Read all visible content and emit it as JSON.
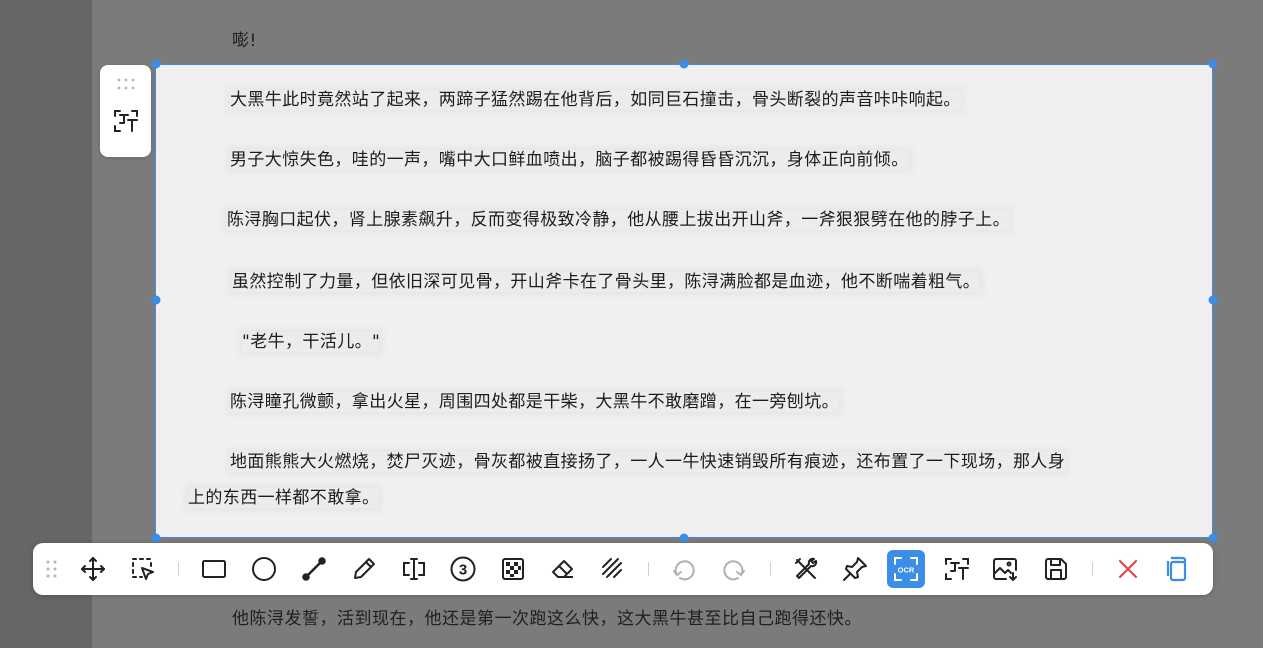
{
  "background_text": {
    "top_line": "嘭!",
    "bottom_line": "他陈浔发誓，活到现在，他还是第一次跑这么快，这大黑牛甚至比自己跑得还快。"
  },
  "selection_paragraphs": [
    "大黑牛此时竟然站了起来，两蹄子猛然踢在他背后，如同巨石撞击，骨头断裂的声音咔咔响起。",
    "男子大惊失色，哇的一声，嘴中大口鲜血喷出，脑子都被踢得昏昏沉沉，身体正向前倾。",
    "陈浔胸口起伏，肾上腺素飙升，反而变得极致冷静，他从腰上拔出开山斧，一斧狠狠劈在他的脖子上。",
    "虽然控制了力量，但依旧深可见骨，开山斧卡在了骨头里，陈浔满脸都是血迹，他不断喘着粗气。",
    "\"老牛，干活儿。\"",
    "陈浔瞳孔微颤，拿出火星，周围四处都是干柴，大黑牛不敢磨蹭，在一旁刨坑。",
    "地面熊熊大火燃烧，焚尸灭迹，骨灰都被直接扬了，一人一牛快速销毁所有痕迹，还布置了一下现场，那人身",
    "上的东西一样都不敢拿。"
  ],
  "side_toolbar": {
    "icons": [
      "drag-handle-icon",
      "ocr-text-icon"
    ]
  },
  "toolbar": {
    "buttons": [
      "drag-handle-icon",
      "move-icon",
      "select-region-icon",
      "rectangle-icon",
      "circle-icon",
      "arrow-icon",
      "pencil-icon",
      "text-cursor-icon",
      "number-marker-icon",
      "mosaic-icon",
      "eraser-icon",
      "hatch-icon",
      "undo-icon",
      "redo-icon",
      "tools-icon",
      "pin-icon",
      "ocr-icon",
      "ocr-text-icon",
      "image-save-icon",
      "save-icon",
      "close-icon",
      "copy-icon"
    ],
    "active_button": "ocr-icon",
    "number_marker": "3",
    "ocr_label": "OCR"
  },
  "colors": {
    "accent": "#3b8de6",
    "close": "#e5484d",
    "selection_bg": "#f0f0f0",
    "overlay": "#7b7b7b"
  }
}
